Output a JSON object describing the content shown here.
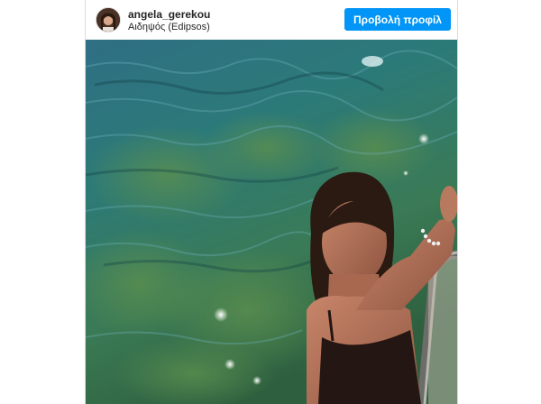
{
  "post": {
    "username": "angela_gerekou",
    "location": "Αιδηψός (Edipsos)",
    "profile_button_label": "Προβολή προφίλ",
    "accent_color": "#0095f6"
  }
}
